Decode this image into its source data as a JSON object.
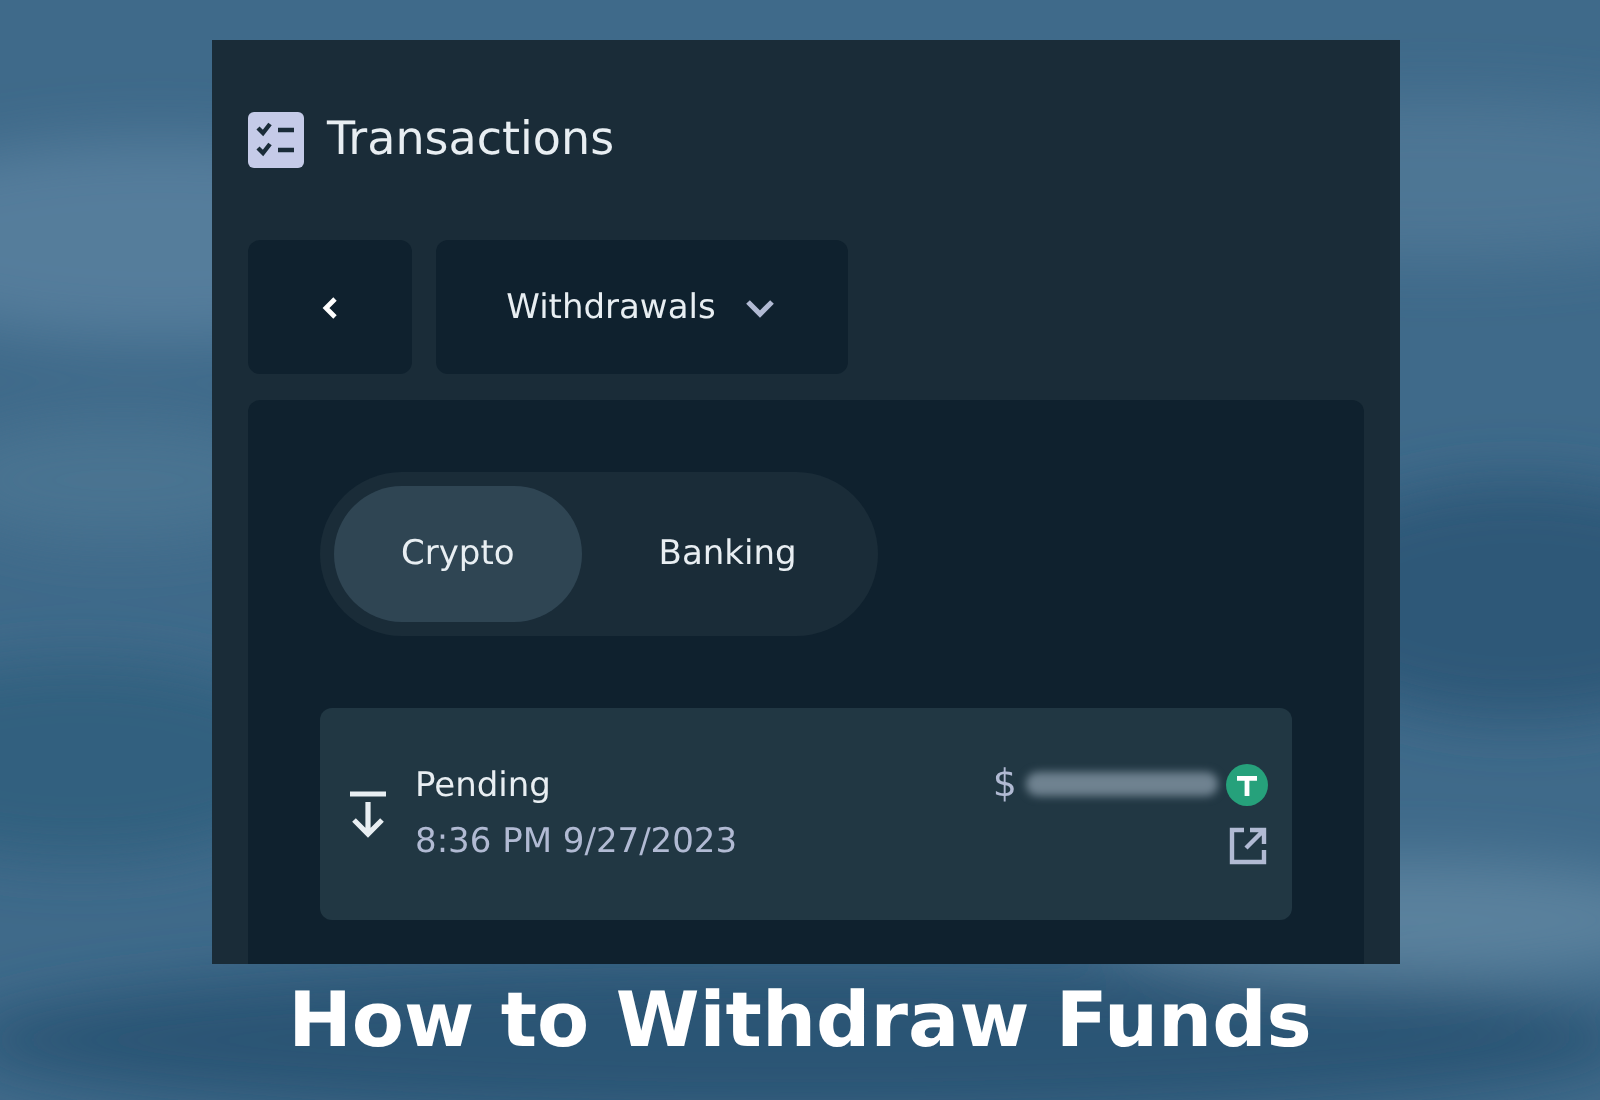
{
  "panel": {
    "title": "Transactions",
    "filter": {
      "label": "Withdrawals"
    },
    "tabs": [
      {
        "label": "Crypto",
        "selected": true
      },
      {
        "label": "Banking",
        "selected": false
      }
    ],
    "transactions": [
      {
        "status": "Pending",
        "time": "8:36 PM 9/27/2023",
        "currency_symbol": "$"
      }
    ]
  },
  "caption": "How to Withdraw Funds"
}
